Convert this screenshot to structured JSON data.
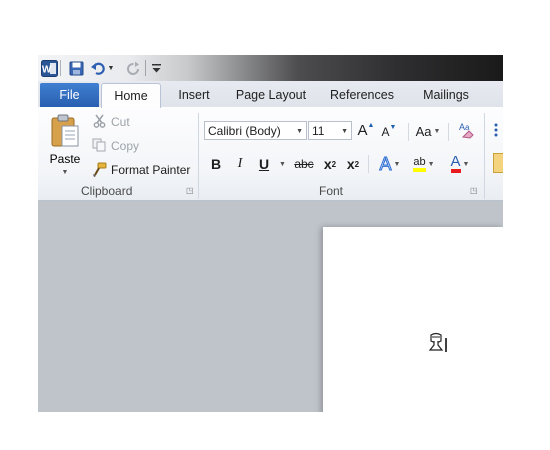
{
  "quick_access": {
    "app_icon": "word-logo-icon",
    "app_letter": "W",
    "save_icon": "save-icon",
    "undo_icon": "undo-icon",
    "redo_icon": "redo-icon",
    "customize_icon": "customize-qat-icon"
  },
  "tabs": [
    {
      "label": "File",
      "active": false
    },
    {
      "label": "Home",
      "active": true
    },
    {
      "label": "Insert",
      "active": false
    },
    {
      "label": "Page Layout",
      "active": false
    },
    {
      "label": "References",
      "active": false
    },
    {
      "label": "Mailings",
      "active": false
    }
  ],
  "clipboard": {
    "group_label": "Clipboard",
    "paste_label": "Paste",
    "cut_label": "Cut",
    "copy_label": "Copy",
    "format_painter_label": "Format Painter"
  },
  "font": {
    "group_label": "Font",
    "font_name": "Calibri (Body)",
    "font_size": "11",
    "grow_label": "A",
    "shrink_label": "A",
    "change_case_label": "Aa",
    "bold_label": "B",
    "italic_label": "I",
    "underline_label": "U",
    "strike_label": "abc",
    "subscript_label": "x",
    "subscript_sub": "2",
    "superscript_label": "x",
    "superscript_sup": "2",
    "text_effects_label": "A",
    "highlight_label": "ab",
    "font_color_label": "A"
  },
  "colors": {
    "file_tab": "#2a5fb0",
    "highlight": "#ffff00",
    "font_color": "#e81c1c",
    "workspace": "#bfc4cb"
  }
}
